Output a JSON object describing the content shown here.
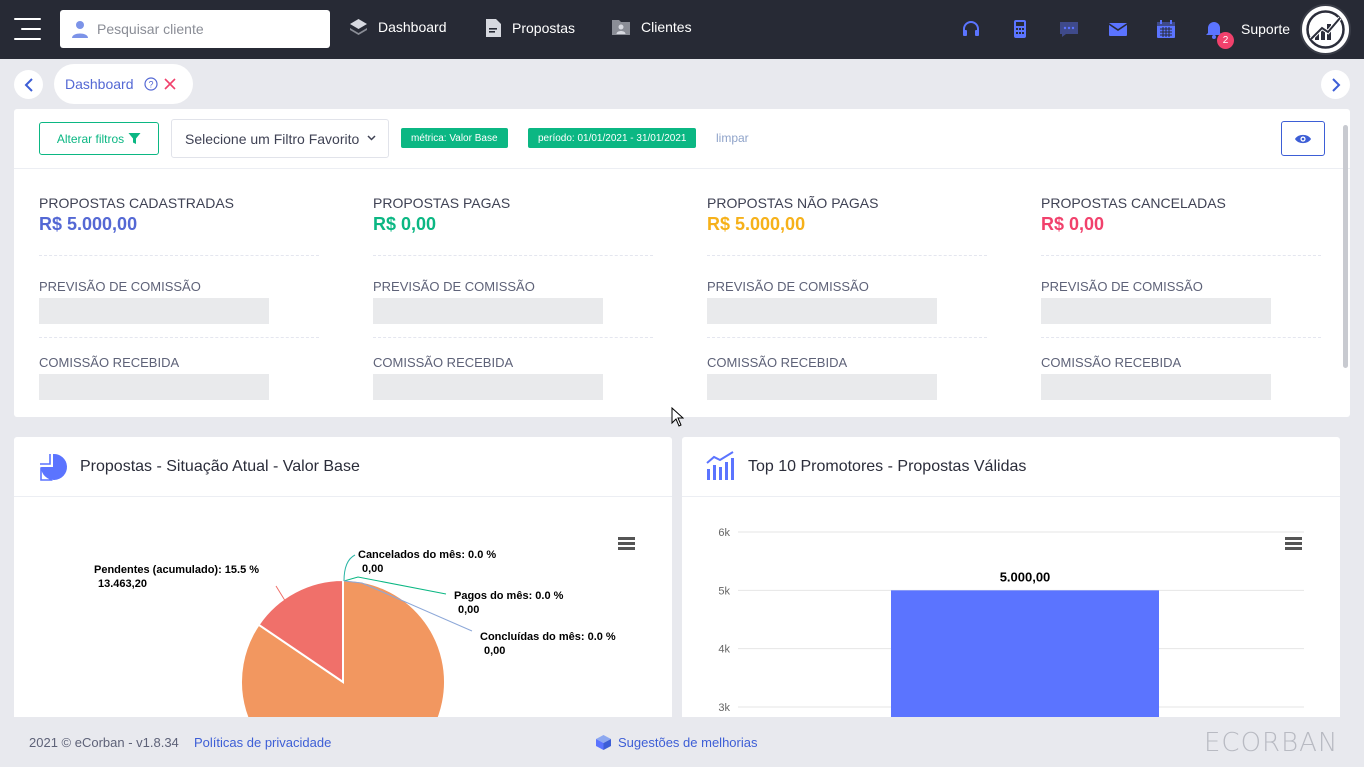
{
  "topbar": {
    "search_placeholder": "Pesquisar cliente",
    "nav": [
      {
        "label": "Dashboard",
        "icon": "layers-icon"
      },
      {
        "label": "Propostas",
        "icon": "document-icon"
      },
      {
        "label": "Clientes",
        "icon": "folder-user-icon"
      }
    ],
    "notification_count": "2",
    "support_label": "Suporte"
  },
  "tabbar": {
    "active_tab": "Dashboard"
  },
  "filters": {
    "change_filters_label": "Alterar filtros",
    "favorite_select_value": "Selecione um Filtro Favorito",
    "chips": [
      "métrica: Valor Base",
      "período: 01/01/2021 - 31/01/2021"
    ],
    "clear_label": "limpar"
  },
  "stats": [
    {
      "title": "PROPOSTAS CADASTRADAS",
      "value": "R$ 5.000,00",
      "color": "#5468d4",
      "forecast_label": "PREVISÃO DE COMISSÃO",
      "received_label": "COMISSÃO RECEBIDA"
    },
    {
      "title": "PROPOSTAS PAGAS",
      "value": "R$ 0,00",
      "color": "#0bb783",
      "forecast_label": "PREVISÃO DE COMISSÃO",
      "received_label": "COMISSÃO RECEBIDA"
    },
    {
      "title": "PROPOSTAS NÃO PAGAS",
      "value": "R$ 5.000,00",
      "color": "#f6b11a",
      "forecast_label": "PREVISÃO DE COMISSÃO",
      "received_label": "COMISSÃO RECEBIDA"
    },
    {
      "title": "PROPOSTAS CANCELADAS",
      "value": "R$ 0,00",
      "color": "#f1416c",
      "forecast_label": "PREVISÃO DE COMISSÃO",
      "received_label": "COMISSÃO RECEBIDA"
    }
  ],
  "pie_card": {
    "title": "Propostas - Situação Atual - Valor Base"
  },
  "bar_card": {
    "title": "Top 10 Promotores - Propostas Válidas"
  },
  "chart_data": [
    {
      "type": "pie",
      "slices": [
        {
          "name": "Pendentes (acumulado)",
          "percent": 15.5,
          "value": "13.463,20",
          "color": "#f0706a"
        },
        {
          "name": "Cancelados do mês",
          "percent": 0.0,
          "value": "0,00",
          "color": "#2ab5a5"
        },
        {
          "name": "Pagos do mês",
          "percent": 0.0,
          "value": "0,00",
          "color": "#0bb783"
        },
        {
          "name": "Concluídas do mês",
          "percent": 0.0,
          "value": "0,00",
          "color": "#8da8d8"
        },
        {
          "name": "",
          "percent": 84.5,
          "value": "",
          "color": "#f29760"
        }
      ]
    },
    {
      "type": "bar",
      "categories": [
        ""
      ],
      "values": [
        5000
      ],
      "data_labels": [
        "5.000,00"
      ],
      "yticks": [
        "3k",
        "4k",
        "5k",
        "6k"
      ],
      "ylim_visible": [
        3000,
        6000
      ],
      "bar_color": "#5b74ff"
    }
  ],
  "footer": {
    "copyright": "2021 © eCorban - v1.8.34",
    "privacy_link": "Políticas de privacidade",
    "suggestions_link": "Sugestões de melhorias",
    "brand": "ECORBAN"
  },
  "colors": {
    "topbar": "#272a35",
    "accent": "#5468d4",
    "success": "#0bb783"
  }
}
